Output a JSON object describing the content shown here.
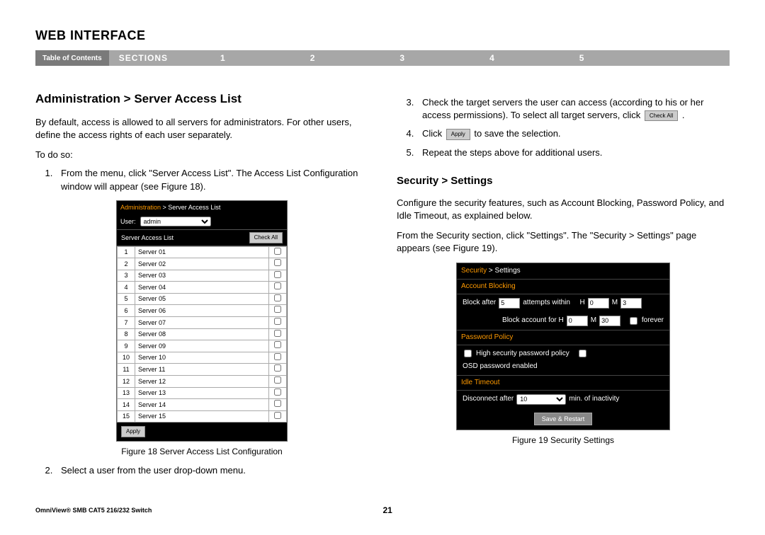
{
  "header": {
    "main_title": "WEB INTERFACE",
    "toc": "Table of Contents",
    "sections_label": "SECTIONS",
    "section_nums": [
      "1",
      "2",
      "3",
      "4",
      "5"
    ]
  },
  "left": {
    "title": "Administration > Server Access List",
    "intro": "By default, access is allowed to all servers for administrators. For other users, define the access rights of each user separately.",
    "todo": "To do so:",
    "step1": "From the menu, click \"Server Access List\". The Access List Configuration window will appear (see Figure 18).",
    "step2": "Select a user from the user drop-down menu.",
    "fig18_caption": "Figure 18 Server Access List Configuration",
    "fig18": {
      "bc_hl": "Administration",
      "bc_rest": " > Server Access List",
      "user_label": "User:",
      "user_value": "admin",
      "list_title": "Server Access List",
      "check_all": "Check All",
      "apply": "Apply",
      "rows": [
        {
          "n": "1",
          "name": "Server 01"
        },
        {
          "n": "2",
          "name": "Server 02"
        },
        {
          "n": "3",
          "name": "Server 03"
        },
        {
          "n": "4",
          "name": "Server 04"
        },
        {
          "n": "5",
          "name": "Server 05"
        },
        {
          "n": "6",
          "name": "Server 06"
        },
        {
          "n": "7",
          "name": "Server 07"
        },
        {
          "n": "8",
          "name": "Server 08"
        },
        {
          "n": "9",
          "name": "Server 09"
        },
        {
          "n": "10",
          "name": "Server 10"
        },
        {
          "n": "11",
          "name": "Server 11"
        },
        {
          "n": "12",
          "name": "Server 12"
        },
        {
          "n": "13",
          "name": "Server 13"
        },
        {
          "n": "14",
          "name": "Server 14"
        },
        {
          "n": "15",
          "name": "Server 15"
        }
      ]
    }
  },
  "right": {
    "step3_a": "Check the target servers the user can access (according to his or her access permissions). To select all target servers, click ",
    "step3_btn": "Check All",
    "step3_b": " .",
    "step4_a": "Click ",
    "step4_btn": "Apply",
    "step4_b": " to save the selection.",
    "step5": "Repeat the steps above for additional users.",
    "sec_title": "Security > Settings",
    "sec_p1": "Configure the security features, such as Account Blocking, Password Policy, and Idle Timeout, as explained below.",
    "sec_p2": "From the Security section, click \"Settings\". The \"Security > Settings\" page appears (see Figure 19).",
    "fig19_caption": "Figure 19 Security Settings",
    "fig19": {
      "bc_hl": "Security",
      "bc_rest": " > Settings",
      "h1": "Account Blocking",
      "r1_a": "Block after",
      "r1_v1": "5",
      "r1_b": "attempts within",
      "r1_h": "H",
      "r1_hv": "0",
      "r1_m": "M",
      "r1_mv": "3",
      "r2_a": "Block account for  H",
      "r2_hv": "0",
      "r2_m": "M",
      "r2_mv": "30",
      "r2_forever": "forever",
      "h2": "Password Policy",
      "r3_a": "High security password policy",
      "r3_b": "OSD password enabled",
      "h3": "Idle Timeout",
      "r4_a": "Disconnect after",
      "r4_v": "10",
      "r4_b": "min. of inactivity",
      "save": "Save & Restart"
    }
  },
  "footer": {
    "product": "OmniView® SMB CAT5 216/232 Switch",
    "page": "21"
  }
}
